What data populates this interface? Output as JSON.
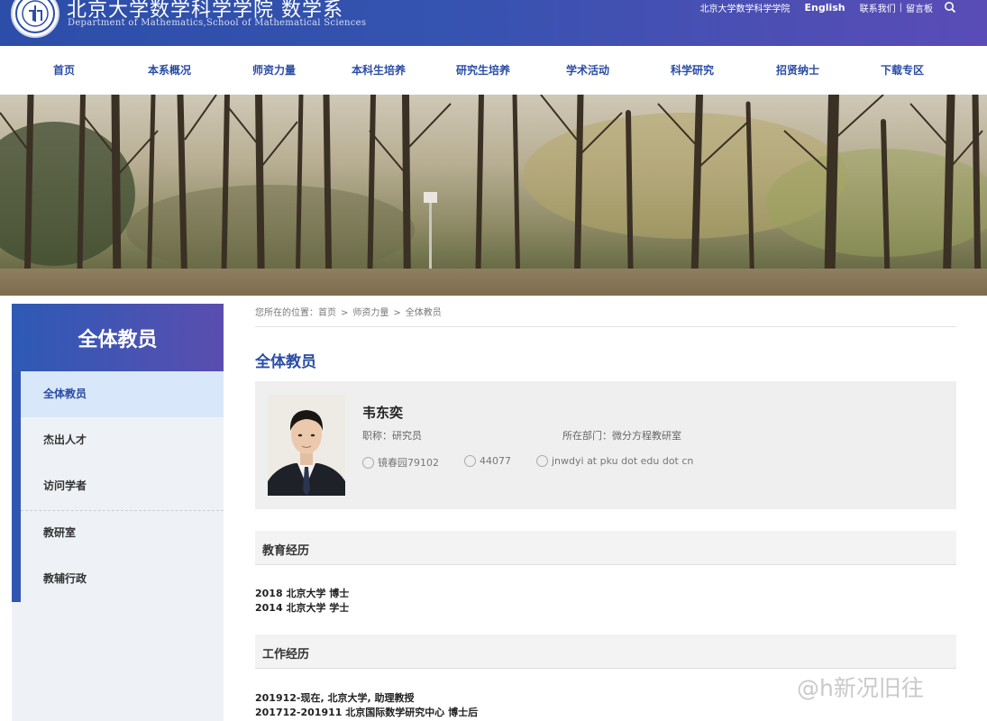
{
  "header": {
    "title": "北京大学数学科学学院 数学系",
    "subtitle": "Department of Mathematics,School of Mathematical Sciences",
    "links": [
      "北京大学数学科学学院",
      "English",
      "联系我们",
      "留言板"
    ]
  },
  "nav": [
    "首页",
    "本系概况",
    "师资力量",
    "本科生培养",
    "研究生培养",
    "学术活动",
    "科学研究",
    "招贤纳士",
    "下载专区"
  ],
  "sidebar": {
    "title": "全体教员",
    "items": [
      "全体教员",
      "杰出人才",
      "访问学者",
      "教研室",
      "教辅行政"
    ]
  },
  "breadcrumb": {
    "prefix": "您所在的位置：",
    "items": [
      "首页",
      "师资力量",
      "全体教员"
    ]
  },
  "page_title": "全体教员",
  "profile": {
    "name": "韦东奕",
    "title": "职称：研究员",
    "department": "所在部门：微分方程教研室",
    "office": "镜春园79102",
    "phone": "44077",
    "email": "jnwdyi at pku dot edu dot cn"
  },
  "education": {
    "heading": "教育经历",
    "entries": [
      "2018 北京大学 博士",
      "2014 北京大学 学士"
    ]
  },
  "work": {
    "heading": "工作经历",
    "entries": [
      "201912-现在, 北京大学, 助理教授",
      "201712-201911 北京国际数学研究中心 博士后"
    ]
  },
  "watermark": "@h新况旧往",
  "colors": {
    "brand_blue": "#2f56b3",
    "brand_purple": "#5a4eb0",
    "nav_text": "#2a4ca6",
    "active_item_bg": "#d9e7fa"
  }
}
